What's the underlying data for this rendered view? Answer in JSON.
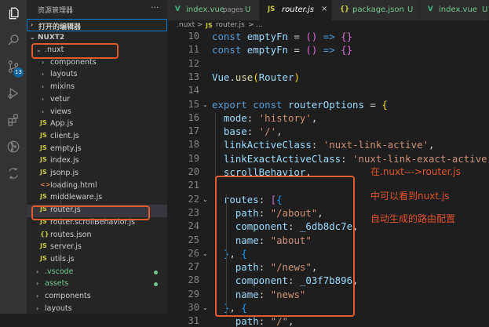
{
  "colors": {
    "keyword": "#569cd6",
    "identifier": "#9cdcfe",
    "function": "#dcdcaa",
    "string": "#ce9178",
    "text": "#d4d4d4",
    "bracket1": "#ffd700",
    "bracket2": "#da70d6",
    "bracket3": "#179fff",
    "highlight": "#e05a2b",
    "js_icon": "#cbcb41",
    "vue_icon": "#41b883"
  },
  "activity_bar": {
    "items": [
      {
        "icon": "files-icon"
      },
      {
        "icon": "search-icon"
      },
      {
        "icon": "source-control-icon",
        "badge": "13"
      },
      {
        "icon": "run-debug-icon"
      },
      {
        "icon": "extensions-icon"
      },
      {
        "icon": "git-graph-icon"
      },
      {
        "icon": "remote-icon"
      }
    ]
  },
  "sidebar": {
    "title": "资源管理器",
    "more": "···",
    "open_editors": {
      "chevron": "›",
      "label": "打开的编辑器"
    },
    "project": {
      "chevron": "⌄",
      "label": "NUXT2"
    },
    "tree": [
      {
        "type": "folder",
        "expanded": true,
        "name": ".nuxt"
      },
      {
        "type": "folder",
        "name": "components"
      },
      {
        "type": "folder",
        "name": "layouts"
      },
      {
        "type": "folder",
        "name": "mixins"
      },
      {
        "type": "folder",
        "name": "vetur"
      },
      {
        "type": "folder",
        "name": "views"
      },
      {
        "type": "file",
        "icon": "JS",
        "name": "App.js"
      },
      {
        "type": "file",
        "icon": "JS",
        "name": "client.js"
      },
      {
        "type": "file",
        "icon": "JS",
        "name": "empty.js"
      },
      {
        "type": "file",
        "icon": "JS",
        "name": "index.js"
      },
      {
        "type": "file",
        "icon": "JS",
        "name": "jsonp.js"
      },
      {
        "type": "file",
        "icon": "<>",
        "name": "loading.html"
      },
      {
        "type": "file",
        "icon": "JS",
        "name": "middleware.js"
      },
      {
        "type": "file",
        "icon": "JS",
        "name": "router.js",
        "selected": true
      },
      {
        "type": "file",
        "icon": "JS",
        "name": "router.scrollBehavior.js"
      },
      {
        "type": "file",
        "icon": "{}",
        "name": "routes.json"
      },
      {
        "type": "file",
        "icon": "JS",
        "name": "server.js"
      },
      {
        "type": "file",
        "icon": "JS",
        "name": "utils.js"
      },
      {
        "type": "folder",
        "name": ".vscode",
        "dot": true
      },
      {
        "type": "folder",
        "name": "assets",
        "dot": true
      },
      {
        "type": "folder",
        "name": "components"
      },
      {
        "type": "folder",
        "name": "layouts"
      }
    ]
  },
  "tabs": [
    {
      "icon": "V",
      "name": "index.vue",
      "hint": "pages",
      "status": "U"
    },
    {
      "icon": "JS",
      "name": "router.js",
      "active": true,
      "close": "×"
    },
    {
      "icon": "{}",
      "name": "package.json",
      "status": "U"
    },
    {
      "icon": "V",
      "name": "index.vue",
      "status": "U"
    }
  ],
  "breadcrumb": {
    "folder": ".nuxt",
    "sep1": ">",
    "file_icon": "JS",
    "file": "router.js",
    "sep2": ">",
    "more": "..."
  },
  "editor": {
    "lines": [
      {
        "n": "10",
        "tokens": [
          [
            "const ",
            "keyword"
          ],
          [
            "emptyFn ",
            "identifier"
          ],
          [
            "= ",
            "text"
          ],
          [
            "() ",
            "bracket2"
          ],
          [
            "=> ",
            "keyword"
          ],
          [
            "{}",
            "bracket2"
          ]
        ]
      },
      {
        "n": "11",
        "tokens": [
          [
            "const ",
            "keyword"
          ],
          [
            "emptyFn ",
            "identifier"
          ],
          [
            "= ",
            "text"
          ],
          [
            "() ",
            "bracket2"
          ],
          [
            "=> ",
            "keyword"
          ],
          [
            "{}",
            "bracket2"
          ]
        ]
      },
      {
        "n": "12",
        "tokens": []
      },
      {
        "n": "13",
        "tokens": [
          [
            "Vue",
            "identifier"
          ],
          [
            ".",
            "text"
          ],
          [
            "use",
            "function"
          ],
          [
            "(",
            "bracket1"
          ],
          [
            "Router",
            "identifier"
          ],
          [
            ")",
            "bracket1"
          ]
        ]
      },
      {
        "n": "14",
        "tokens": []
      },
      {
        "n": "15",
        "fold": "⌄",
        "tokens": [
          [
            "export ",
            "keyword"
          ],
          [
            "const ",
            "keyword"
          ],
          [
            "routerOptions ",
            "identifier"
          ],
          [
            "= ",
            "text"
          ],
          [
            "{",
            "bracket1"
          ]
        ]
      },
      {
        "n": "16",
        "tokens": [
          [
            "  mode",
            "identifier"
          ],
          [
            ": ",
            "text"
          ],
          [
            "'history'",
            "string"
          ],
          [
            ",",
            "text"
          ]
        ]
      },
      {
        "n": "17",
        "tokens": [
          [
            "  base",
            "identifier"
          ],
          [
            ": ",
            "text"
          ],
          [
            "'/'",
            "string"
          ],
          [
            ",",
            "text"
          ]
        ]
      },
      {
        "n": "18",
        "tokens": [
          [
            "  linkActiveClass",
            "identifier"
          ],
          [
            ": ",
            "text"
          ],
          [
            "'nuxt-link-active'",
            "string"
          ],
          [
            ",",
            "text"
          ]
        ]
      },
      {
        "n": "19",
        "tokens": [
          [
            "  linkExactActiveClass",
            "identifier"
          ],
          [
            ": ",
            "text"
          ],
          [
            "'nuxt-link-exact-active'",
            "string"
          ],
          [
            ",",
            "text"
          ]
        ]
      },
      {
        "n": "20",
        "tokens": [
          [
            "  scrollBehavior",
            "identifier"
          ],
          [
            ",",
            "text"
          ]
        ]
      },
      {
        "n": "21",
        "tokens": []
      },
      {
        "n": "22",
        "fold": "⌄",
        "tokens": [
          [
            "  routes",
            "identifier"
          ],
          [
            ": ",
            "text"
          ],
          [
            "[",
            "bracket2"
          ],
          [
            "{",
            "bracket3"
          ]
        ]
      },
      {
        "n": "23",
        "tokens": [
          [
            "    path",
            "identifier"
          ],
          [
            ": ",
            "text"
          ],
          [
            "\"/about\"",
            "string"
          ],
          [
            ",",
            "text"
          ]
        ]
      },
      {
        "n": "24",
        "tokens": [
          [
            "    component",
            "identifier"
          ],
          [
            ": ",
            "text"
          ],
          [
            "_6db8dc7e",
            "identifier"
          ],
          [
            ",",
            "text"
          ]
        ]
      },
      {
        "n": "25",
        "tokens": [
          [
            "    name",
            "identifier"
          ],
          [
            ": ",
            "text"
          ],
          [
            "\"about\"",
            "string"
          ]
        ]
      },
      {
        "n": "26",
        "fold": "⌄",
        "tokens": [
          [
            "  ",
            "text"
          ],
          [
            "}",
            "bracket3"
          ],
          [
            ", ",
            "text"
          ],
          [
            "{",
            "bracket3"
          ]
        ]
      },
      {
        "n": "27",
        "tokens": [
          [
            "    path",
            "identifier"
          ],
          [
            ": ",
            "text"
          ],
          [
            "\"/news\"",
            "string"
          ],
          [
            ",",
            "text"
          ]
        ]
      },
      {
        "n": "28",
        "tokens": [
          [
            "    component",
            "identifier"
          ],
          [
            ": ",
            "text"
          ],
          [
            "_03f7b896",
            "identifier"
          ],
          [
            ",",
            "text"
          ]
        ]
      },
      {
        "n": "29",
        "tokens": [
          [
            "    name",
            "identifier"
          ],
          [
            ": ",
            "text"
          ],
          [
            "\"news\"",
            "string"
          ]
        ]
      },
      {
        "n": "30",
        "fold": "⌄",
        "tokens": [
          [
            "  ",
            "text"
          ],
          [
            "}",
            "bracket3"
          ],
          [
            ", ",
            "text"
          ],
          [
            "{",
            "bracket3"
          ]
        ]
      },
      {
        "n": "31",
        "tokens": [
          [
            "    path",
            "identifier"
          ],
          [
            ": ",
            "text"
          ],
          [
            "\"/\"",
            "string"
          ],
          [
            ",",
            "text"
          ]
        ]
      }
    ]
  },
  "annotations": [
    "在.nuxt--->router.js",
    "中可以看到nuxt.js",
    "自动生成的路由配置"
  ]
}
